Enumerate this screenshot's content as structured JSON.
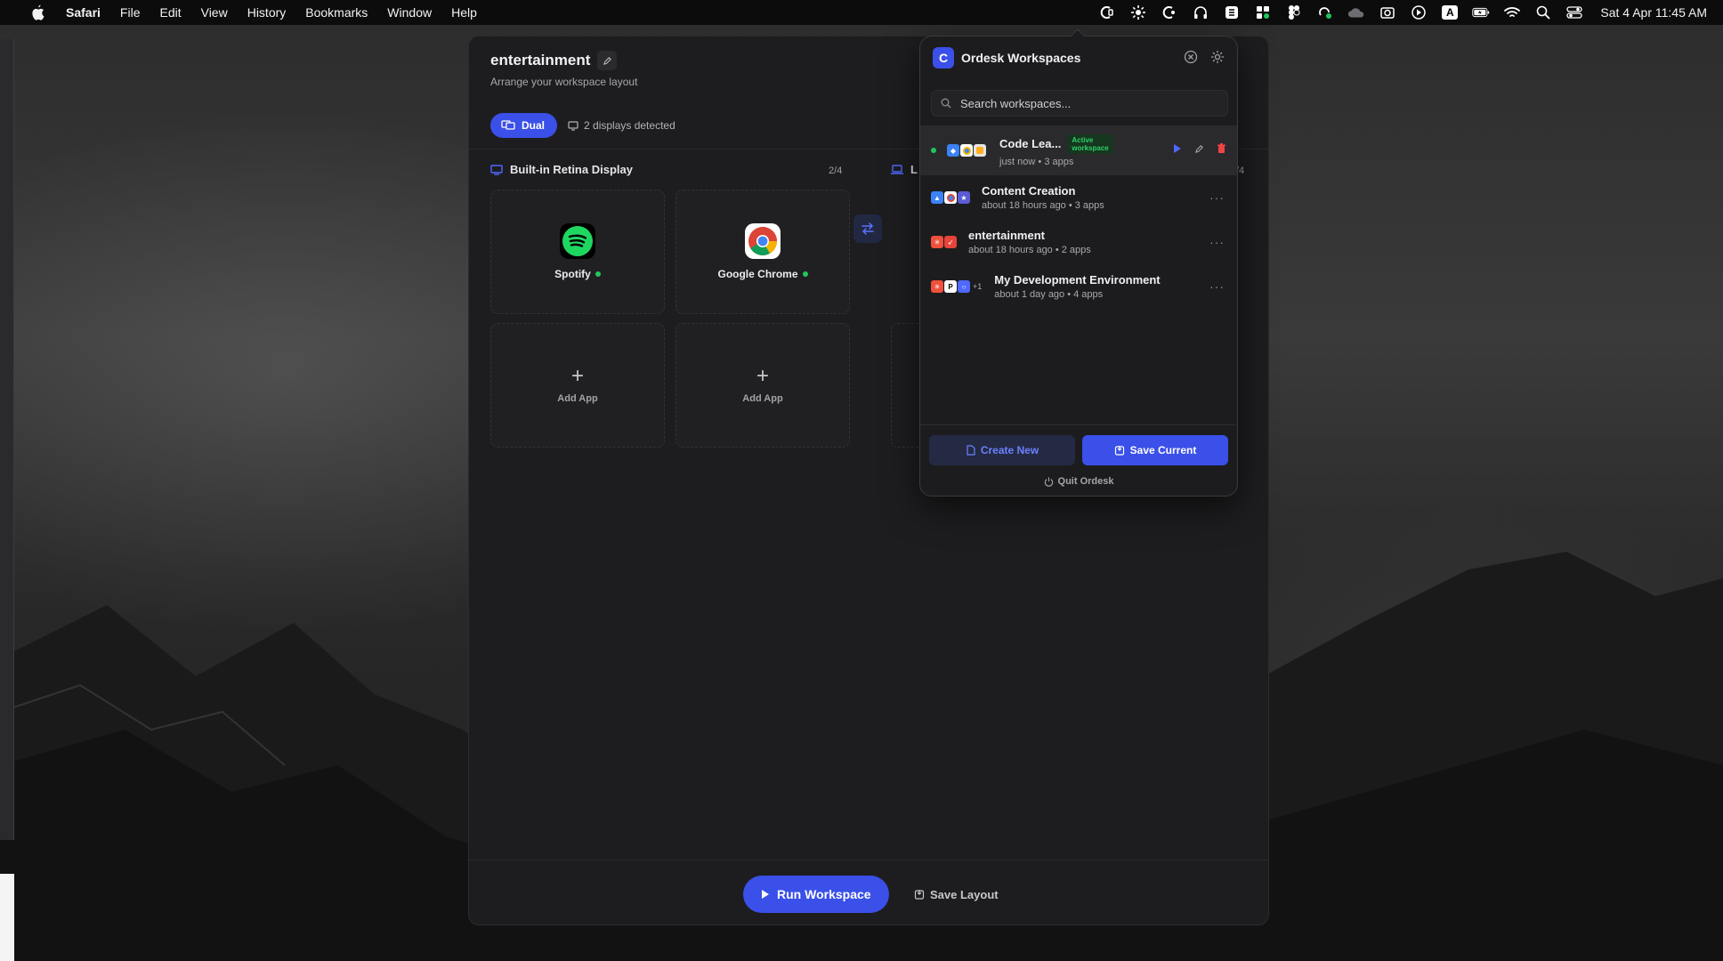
{
  "menubar": {
    "app_name": "Safari",
    "menus": [
      "File",
      "Edit",
      "View",
      "History",
      "Bookmarks",
      "Window",
      "Help"
    ],
    "clock": "Sat 4 Apr  11:45 AM",
    "tray_icons": [
      "ordesk-icon",
      "sun-icon",
      "moon-app-icon",
      "headphones-icon",
      "shield-icon",
      "app-store-icon",
      "figma-icon",
      "tray-app-icon",
      "cloud-icon",
      "camera-icon",
      "play-icon",
      "keyboard-a-icon",
      "battery-icon",
      "wifi-icon",
      "search-icon",
      "control-center-icon"
    ],
    "keyboard_label": "A"
  },
  "window": {
    "title": "entertainment",
    "subtitle": "Arrange your workspace layout",
    "mode_label": "Dual",
    "displays_detected": "2 displays detected",
    "display1": {
      "name": "Built-in Retina Display",
      "count": "2/4",
      "apps": [
        {
          "name": "Spotify",
          "running": true
        },
        {
          "name": "Google Chrome",
          "running": true
        }
      ],
      "add_label": "Add App",
      "add_symbol": "+"
    },
    "display2": {
      "name_peek": "L",
      "count_peek": "/4"
    },
    "run_label": "Run Workspace",
    "save_layout_label": "Save Layout"
  },
  "popover": {
    "title": "Ordesk Workspaces",
    "logo_letter": "C",
    "search_placeholder": "Search workspaces...",
    "workspaces": [
      {
        "name": "Code Lea...",
        "meta": "just now • 3 apps",
        "badge": "Active\nworkspace",
        "active": true
      },
      {
        "name": "Content Creation",
        "meta": "about 18 hours ago • 3 apps",
        "active": false
      },
      {
        "name": "entertainment",
        "meta": "about 18 hours ago • 2 apps",
        "active": false
      },
      {
        "name": "My Development Environment",
        "meta": "about 1 day ago • 4 apps",
        "extra_count": "+1",
        "active": false
      }
    ],
    "more_symbol": "···",
    "create_label": "Create New",
    "save_current_label": "Save Current",
    "quit_label": "Quit Ordesk"
  },
  "colors": {
    "accent": "#3a50e8",
    "active_green": "#22c55e",
    "delete_red": "#ef4444"
  }
}
